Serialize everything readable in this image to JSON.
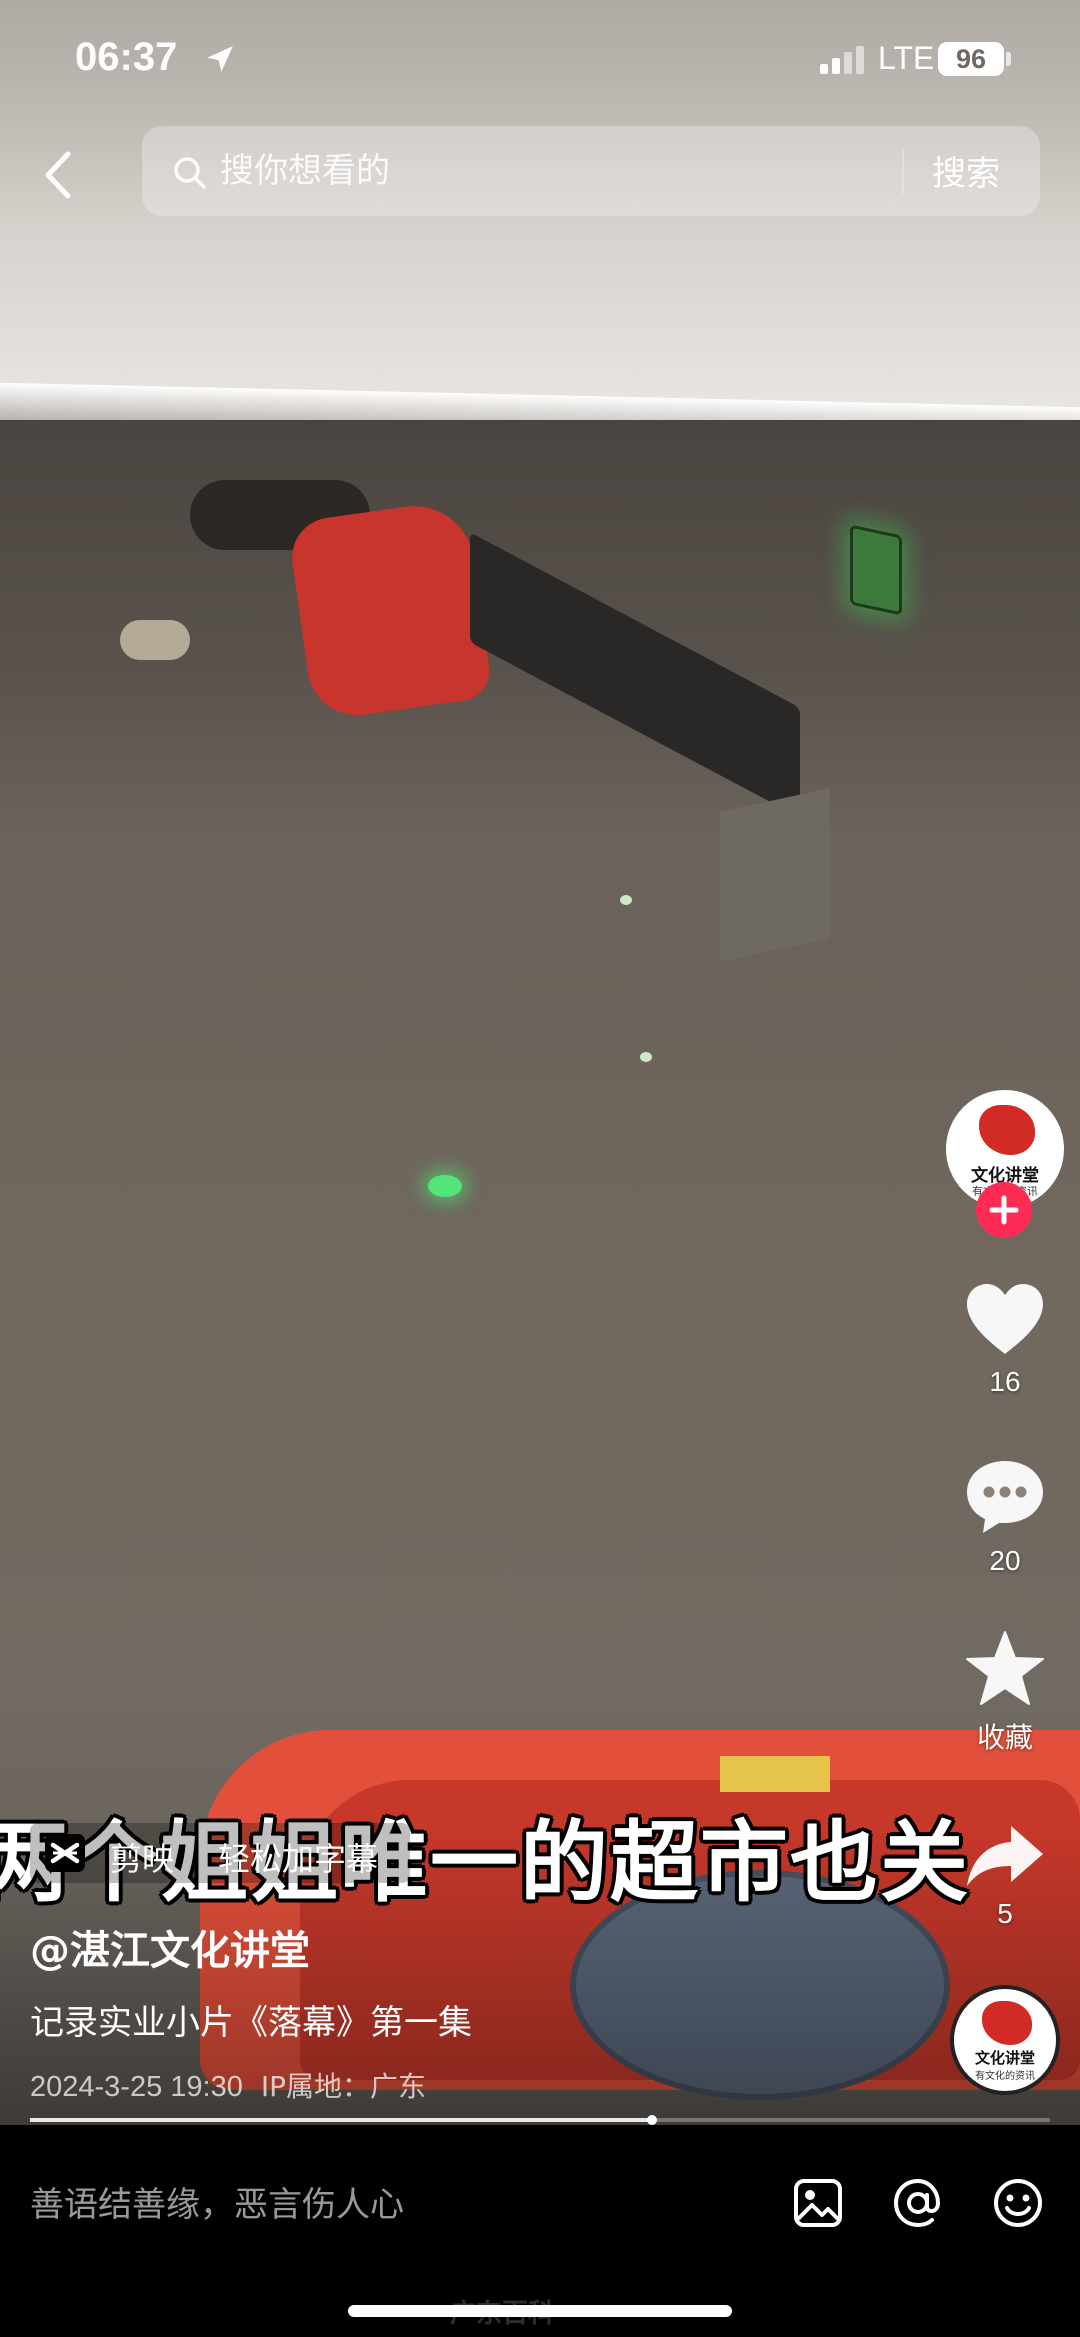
{
  "status_bar": {
    "time": "06:37",
    "network": "LTE",
    "battery": "96"
  },
  "search": {
    "placeholder": "搜你想看的",
    "button_label": "搜索"
  },
  "video": {
    "subtitle": "两个姐姐唯一的超市也关",
    "progress": 0.61,
    "capcut": {
      "app_name": "剪映",
      "slogan": "轻松加字幕"
    }
  },
  "creator": {
    "handle": "@湛江文化讲堂",
    "avatar_title": "文化讲堂",
    "avatar_subtitle": "有文化的资讯"
  },
  "actions": {
    "likes": "16",
    "comments": "20",
    "favorites_label": "收藏",
    "shares": "5"
  },
  "post": {
    "description": "记录实业小片《落幕》第一集",
    "date": "2024-3-25 19:30",
    "ip_location": "IP属地：广东"
  },
  "comment_bar": {
    "placeholder": "善语结善缘，恶言伤人心"
  },
  "watermark": "广东百科",
  "colors": {
    "follow_accent": "#fe2c55",
    "avatar_red": "#d22a25"
  }
}
